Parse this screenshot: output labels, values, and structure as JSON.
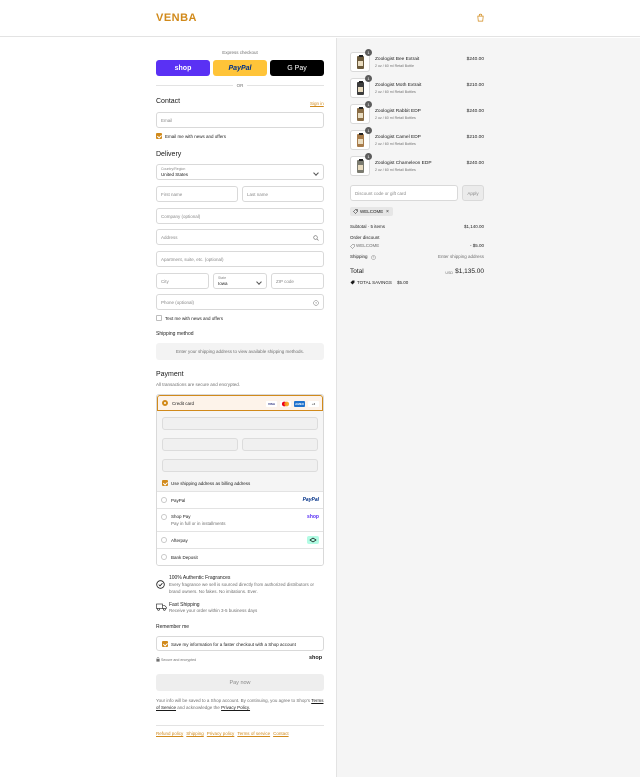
{
  "brand": {
    "logo_text": "VENBA",
    "accent_color": "#d18a1b"
  },
  "express": {
    "title": "Express checkout",
    "buttons": [
      {
        "label": "shop",
        "icon": "shop-pay-logo"
      },
      {
        "label": "PayPal",
        "icon": "paypal-logo"
      },
      {
        "label": "G Pay",
        "icon": "google-pay-logo"
      }
    ],
    "divider": "OR"
  },
  "contact": {
    "title": "Contact",
    "sign_in": "Sign in",
    "email_placeholder": "Email",
    "news_label": "Email me with news and offers",
    "news_checked": true
  },
  "delivery": {
    "title": "Delivery",
    "country_label": "Country/Region",
    "country_value": "United States",
    "first_name": "First name",
    "last_name": "Last name",
    "company": "Company (optional)",
    "address": "Address",
    "apartment": "Apartment, suite, etc. (optional)",
    "city": "City",
    "state_label": "State",
    "state_value": "Iowa",
    "zip": "ZIP code",
    "phone": "Phone (optional)",
    "text_me_label": "Text me with news and offers",
    "text_me_checked": false
  },
  "shipping": {
    "title": "Shipping method",
    "message": "Enter your shipping address to view available shipping methods."
  },
  "payment": {
    "title": "Payment",
    "subtitle": "All transactions are secure and encrypted.",
    "credit_card_label": "Credit card",
    "card_brands": [
      "VISA",
      "MC",
      "AMEX",
      "+3"
    ],
    "billing_label": "Use shipping address as billing address",
    "billing_checked": true,
    "methods": [
      {
        "label": "PayPal",
        "logo": "PayPal"
      },
      {
        "label": "Shop Pay",
        "sub": "Pay in full or in installments",
        "logo": "shop"
      },
      {
        "label": "Afterpay",
        "logo": "afterpay"
      },
      {
        "label": "Bank Deposit",
        "logo": ""
      }
    ]
  },
  "features": [
    {
      "title": "100% Authentic Fragrances",
      "text": "Every fragrance we sell is sourced directly from authorized distributors or brand owners. No fakes. No imitations. Ever.",
      "icon": "check-circle-icon"
    },
    {
      "title": "Fast Shipping",
      "text": "Receive your order within 3-5 business days",
      "icon": "truck-icon"
    }
  ],
  "remember": {
    "title": "Remember me",
    "save_label": "Save my information for a faster checkout with a Shop account",
    "save_checked": true,
    "secure_label": "Secure and encrypted",
    "shop_label": "shop"
  },
  "pay_now": "Pay now",
  "fine_print": {
    "before": "Your info will be saved to a Shop account. By continuing, you agree to Shop's",
    "terms": "Terms of Service",
    "middle": "and acknowledge the",
    "privacy": "Privacy Policy."
  },
  "footer_links": [
    "Refund policy",
    "Shipping",
    "Privacy policy",
    "Terms of service",
    "Contact"
  ],
  "order": {
    "items": [
      {
        "name": "Zoologist Bee Extrait",
        "variant": "2 oz / 60 ml Retail Bottle",
        "price": "$240.00",
        "qty": "1"
      },
      {
        "name": "Zoologist Moth Extrait",
        "variant": "2 oz / 60 ml Retail Bottles",
        "price": "$210.00",
        "qty": "1"
      },
      {
        "name": "Zoologist Rabbit EDP",
        "variant": "2 oz / 60 ml Retail Bottles",
        "price": "$240.00",
        "qty": "1"
      },
      {
        "name": "Zoologist Camel EDP",
        "variant": "2 oz / 60 ml Retail Bottles",
        "price": "$210.00",
        "qty": "1"
      },
      {
        "name": "Zoologist Chameleon EDP",
        "variant": "2 oz / 60 ml Retail Bottles",
        "price": "$240.00",
        "qty": "1"
      }
    ],
    "discount_placeholder": "Discount code or gift card",
    "apply_label": "Apply",
    "code_chip": "WELCOME",
    "subtotal_label": "Subtotal · 5 items",
    "subtotal_value": "$1,140.00",
    "order_discount_label": "Order discount",
    "discount_code": "WELCOME",
    "discount_value": "- $5.00",
    "shipping_label": "Shipping",
    "shipping_value": "Enter shipping address",
    "total_label": "Total",
    "total_currency": "USD",
    "total_value": "$1,135.00",
    "savings_label": "TOTAL SAVINGS",
    "savings_value": "$5.00"
  }
}
